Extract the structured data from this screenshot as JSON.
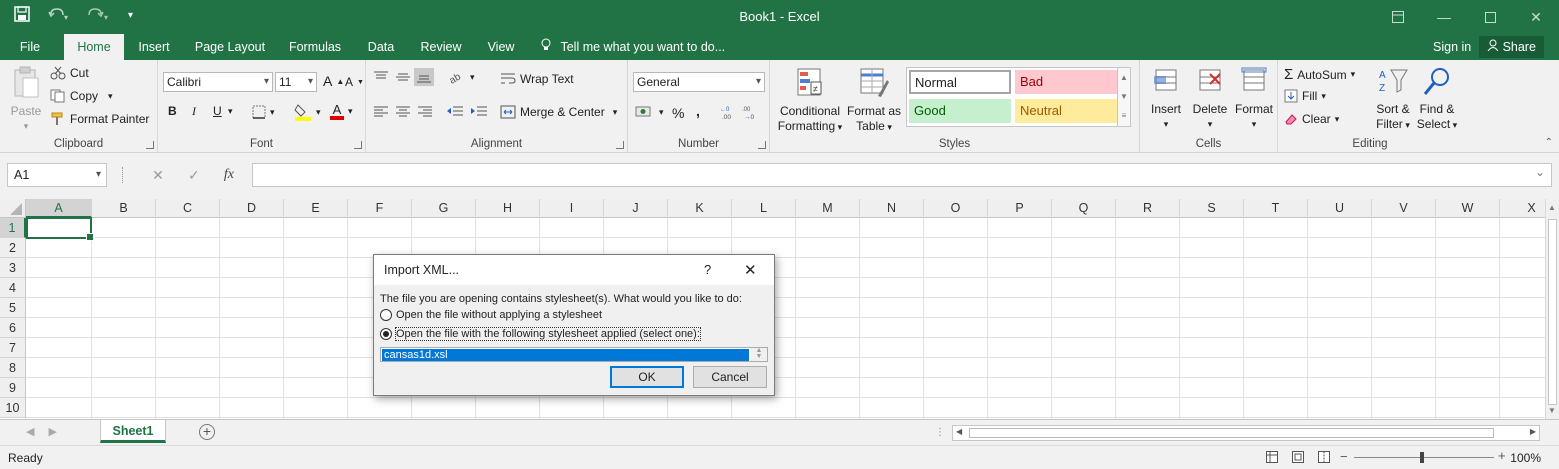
{
  "window": {
    "title": "Book1  -  Excel",
    "qat_icons": [
      "save-icon",
      "undo-icon",
      "redo-icon",
      "customize-qat-icon"
    ],
    "controls": [
      "ribbon-display-icon",
      "minimize-icon",
      "maximize-icon",
      "close-icon"
    ]
  },
  "tabs": [
    {
      "label": "File"
    },
    {
      "label": "Home",
      "active": true
    },
    {
      "label": "Insert"
    },
    {
      "label": "Page Layout"
    },
    {
      "label": "Formulas"
    },
    {
      "label": "Data"
    },
    {
      "label": "Review"
    },
    {
      "label": "View"
    }
  ],
  "tell_me": "Tell me what you want to do...",
  "sign_in": "Sign in",
  "share": "Share",
  "ribbon": {
    "clipboard": {
      "label": "Clipboard",
      "paste": "Paste",
      "cut": "Cut",
      "copy": "Copy",
      "format_painter": "Format Painter"
    },
    "font": {
      "label": "Font",
      "name": "Calibri",
      "size": "11",
      "bold": "B",
      "italic": "I",
      "underline": "U",
      "grow": "A",
      "shrink": "A",
      "color_letter": "A"
    },
    "alignment": {
      "label": "Alignment",
      "wrap_text": "Wrap Text",
      "merge_center": "Merge & Center"
    },
    "number": {
      "label": "Number",
      "format": "General",
      "percent": "%",
      "comma": ","
    },
    "styles": {
      "label": "Styles",
      "conditional": [
        "Conditional",
        "Formatting"
      ],
      "format_table": [
        "Format as",
        "Table"
      ],
      "cells": [
        {
          "label": "Normal",
          "bg": "#ffffff",
          "fg": "#000000"
        },
        {
          "label": "Bad",
          "bg": "#ffc7ce",
          "fg": "#9c0006"
        },
        {
          "label": "Good",
          "bg": "#c6efce",
          "fg": "#006100"
        },
        {
          "label": "Neutral",
          "bg": "#ffeb9c",
          "fg": "#9c5700"
        }
      ]
    },
    "cells": {
      "label": "Cells",
      "insert": "Insert",
      "delete": "Delete",
      "format": "Format"
    },
    "editing": {
      "label": "Editing",
      "autosum": "AutoSum",
      "fill": "Fill",
      "clear": "Clear",
      "sort_filter": [
        "Sort &",
        "Filter"
      ],
      "find_select": [
        "Find &",
        "Select"
      ]
    }
  },
  "formula_bar": {
    "name_box": "A1",
    "fx": "fx",
    "cancel": "✕",
    "enter": "✓"
  },
  "grid": {
    "columns": [
      "A",
      "B",
      "C",
      "D",
      "E",
      "F",
      "G",
      "H",
      "I",
      "J",
      "K",
      "L",
      "M",
      "N",
      "O",
      "P",
      "Q",
      "R",
      "S",
      "T",
      "U",
      "V",
      "W",
      "X"
    ],
    "rows": [
      "1",
      "2",
      "3",
      "4",
      "5",
      "6",
      "7",
      "8",
      "9",
      "10"
    ],
    "selected_cell": "A1"
  },
  "sheets": [
    {
      "name": "Sheet1",
      "active": true
    }
  ],
  "status": {
    "ready": "Ready",
    "zoom": "100%"
  },
  "dialog": {
    "title": "Import XML...",
    "help": "?",
    "close": "✕",
    "prompt": "The file you are opening contains stylesheet(s).  What would you like to do:",
    "option_without": "Open the file without applying a stylesheet",
    "option_with": "Open the file with the following stylesheet applied (select one):",
    "selected_option": "with",
    "stylesheets": [
      "cansas1d.xsl"
    ],
    "ok": "OK",
    "cancel": "Cancel"
  },
  "colors": {
    "excel_green": "#217346",
    "ribbon_bg": "#f1f1f1",
    "selection_blue": "#0078d7"
  }
}
